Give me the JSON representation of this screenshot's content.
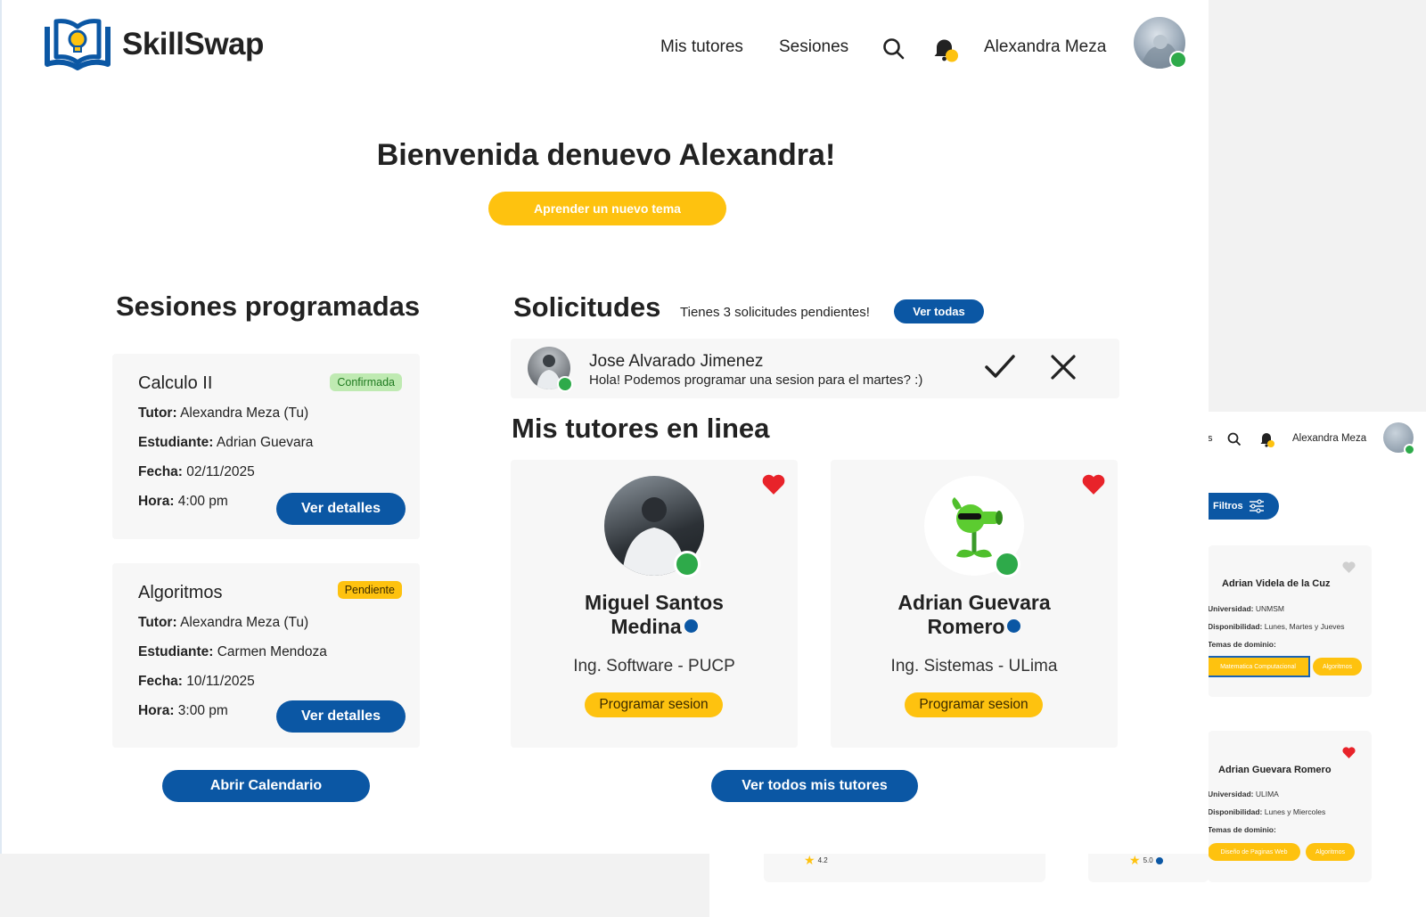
{
  "colors": {
    "brand_blue": "#0b57a4",
    "accent_yellow": "#fec20f",
    "online_green": "#2eaa4a",
    "heart_red": "#e8232a"
  },
  "header": {
    "brand": "SkillSwap",
    "nav": [
      "Mis tutores",
      "Sesiones"
    ],
    "user_name": "Alexandra Meza",
    "icons": [
      "logo-book-lightbulb-icon",
      "search-icon",
      "bell-icon"
    ]
  },
  "hero": {
    "welcome": "Bienvenida denuevo Alexandra!",
    "learn_button": "Aprender un nuevo tema"
  },
  "sessions": {
    "title": "Sesiones programadas",
    "items": [
      {
        "course": "Calculo II",
        "status": "Confirmada",
        "tutor_label": "Tutor:",
        "tutor": "Alexandra Meza (Tu)",
        "student_label": "Estudiante:",
        "student": "Adrian Guevara",
        "date_label": "Fecha:",
        "date": "02/11/2025",
        "time_label": "Hora:",
        "time": "4:00 pm",
        "button": "Ver detalles"
      },
      {
        "course": "Algoritmos",
        "status": "Pendiente",
        "tutor_label": "Tutor:",
        "tutor": "Alexandra Meza (Tu)",
        "student_label": "Estudiante:",
        "student": "Carmen Mendoza",
        "date_label": "Fecha:",
        "date": "10/11/2025",
        "time_label": "Hora:",
        "time": "3:00 pm",
        "button": "Ver detalles"
      }
    ],
    "calendar_button": "Abrir Calendario"
  },
  "requests": {
    "title": "Solicitudes",
    "pending_text": "Tienes 3 solicitudes pendientes!",
    "see_all": "Ver todas",
    "item": {
      "name": "Jose Alvarado Jimenez",
      "message": "Hola! Podemos programar una sesion para el martes? :)"
    }
  },
  "tutors": {
    "title": "Mis tutores en linea",
    "items": [
      {
        "name_line1": "Miguel Santos",
        "name_line2": "Medina",
        "school": "Ing. Software - PUCP",
        "button": "Programar sesion"
      },
      {
        "name_line1": "Adrian Guevara",
        "name_line2": "Romero",
        "school": "Ing. Sistemas - ULima",
        "button": "Programar sesion"
      }
    ],
    "all_button": "Ver todos mis tutores"
  },
  "background_screen": {
    "nav_fragment": "s",
    "user_name": "Alexandra Meza",
    "filters_button": "Filtros",
    "cards": [
      {
        "name": "Adrian Videla de la Cuz",
        "university_label": "Universidad:",
        "university": "UNMSM",
        "availability_label": "Disponibilidad:",
        "availability": "Lunes, Martes y Jueves",
        "topics_label": "Temas de dominio:",
        "topics": [
          "Matematica Computacional",
          "Algoritmos"
        ]
      },
      {
        "name": "Adrian Guevara Romero",
        "university_label": "Universidad:",
        "university": "ULIMA",
        "availability_label": "Disponibilidad:",
        "availability": "Lunes y Miercoles",
        "topics_label": "Temas de dominio:",
        "topics": [
          "Diseño de Paginas Web",
          "Algoritmos"
        ]
      }
    ],
    "ratings": [
      "4.2",
      "5.0"
    ]
  }
}
